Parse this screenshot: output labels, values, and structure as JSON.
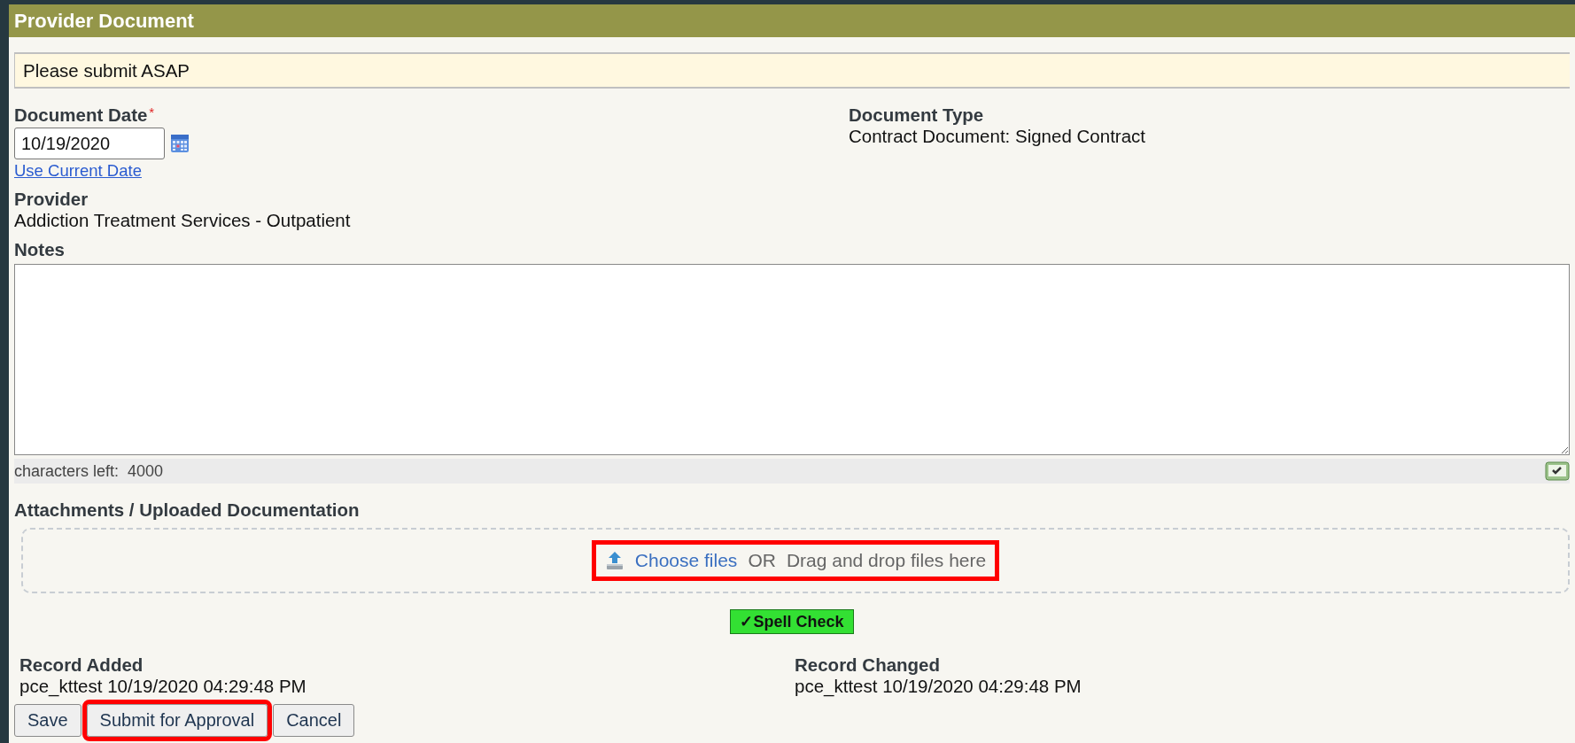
{
  "window": {
    "title": "Provider Document"
  },
  "message": "Please submit ASAP",
  "document_date": {
    "label": "Document Date",
    "required_mark": "*",
    "value": "10/19/2020",
    "link": "Use Current Date"
  },
  "document_type": {
    "label": "Document Type",
    "value": "Contract Document: Signed Contract"
  },
  "provider": {
    "label": "Provider",
    "value": "Addiction Treatment Services - Outpatient"
  },
  "notes": {
    "label": "Notes",
    "counter_label": "characters left:",
    "counter": "4000"
  },
  "attachments": {
    "label": "Attachments / Uploaded Documentation",
    "choose": "Choose files",
    "separator": "OR",
    "drop_hint": "Drag and drop files here",
    "highlighted": true
  },
  "spell_check": {
    "label": "✓Spell Check"
  },
  "record_added": {
    "label": "Record Added",
    "value": "pce_kttest 10/19/2020 04:29:48 PM"
  },
  "record_changed": {
    "label": "Record Changed",
    "value": "pce_kttest 10/19/2020 04:29:48 PM"
  },
  "buttons": [
    {
      "label": "Save",
      "highlighted": false
    },
    {
      "label": "Submit for Approval",
      "highlighted": true
    },
    {
      "label": "Cancel",
      "highlighted": false
    }
  ]
}
